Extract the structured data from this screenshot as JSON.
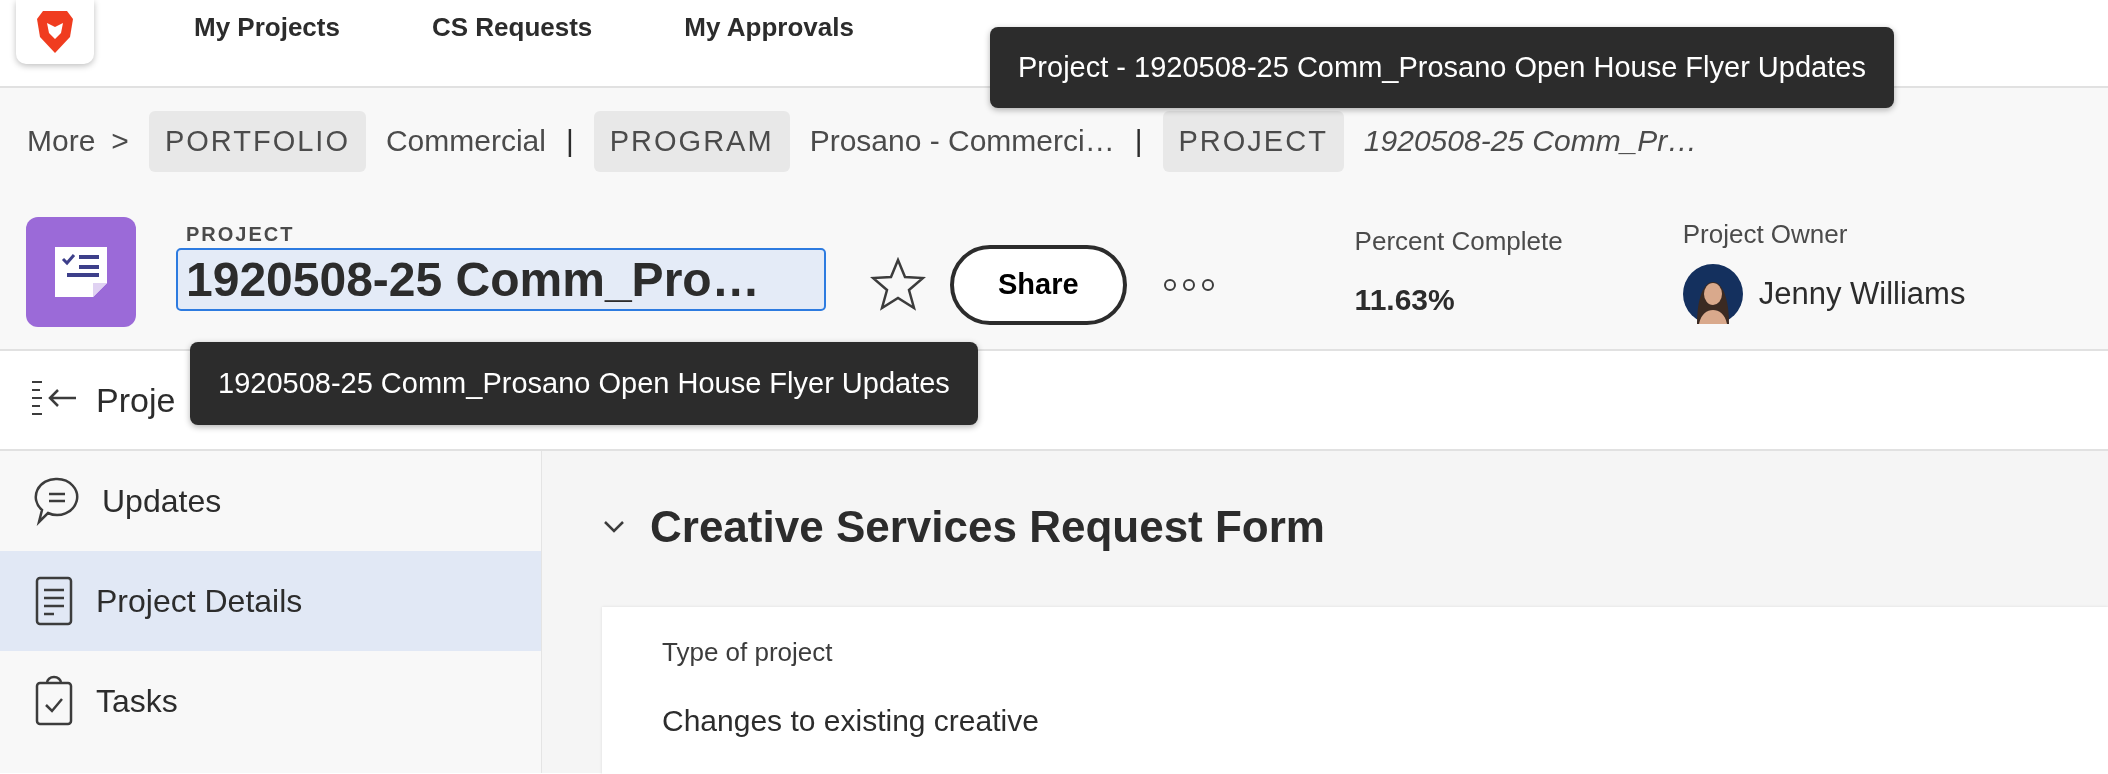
{
  "top_nav": [
    {
      "label": "My Projects"
    },
    {
      "label": "CS Requests"
    },
    {
      "label": "My Approvals"
    }
  ],
  "breadcrumb": {
    "more": "More",
    "more_arrow": ">",
    "items": [
      {
        "kind": "chip",
        "text": "PORTFOLIO"
      },
      {
        "kind": "link",
        "text": "Commercial"
      },
      {
        "kind": "divider",
        "text": "|"
      },
      {
        "kind": "chip",
        "text": "PROGRAM"
      },
      {
        "kind": "link",
        "text": "Prosano - Commerci…"
      },
      {
        "kind": "divider",
        "text": "|"
      },
      {
        "kind": "chip",
        "text": "PROJECT"
      },
      {
        "kind": "current",
        "text": "1920508-25 Comm_Pr…"
      }
    ]
  },
  "header": {
    "eyebrow": "PROJECT",
    "title": "1920508-25 Comm_Pro…",
    "share": "Share",
    "percent": {
      "label": "Percent Complete",
      "value": "11.63%"
    },
    "owner": {
      "label": "Project Owner",
      "name": "Jenny Williams"
    }
  },
  "panel_title": "Proje",
  "tooltips": [
    {
      "text": "Project - 1920508-25 Comm_Prosano Open House Flyer Updates"
    },
    {
      "text": "1920508-25 Comm_Prosano Open House Flyer Updates"
    }
  ],
  "sidebar": {
    "items": [
      {
        "kind": "updates",
        "label": "Updates",
        "selected": false
      },
      {
        "kind": "details",
        "label": "Project Details",
        "selected": true
      },
      {
        "kind": "tasks",
        "label": "Tasks",
        "selected": false
      }
    ]
  },
  "section": {
    "title": "Creative Services Request Form",
    "expanded": true,
    "fields": [
      {
        "label": "Type of project",
        "value": "Changes to existing creative"
      }
    ]
  }
}
